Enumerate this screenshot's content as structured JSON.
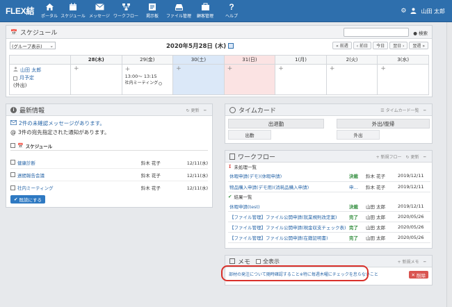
{
  "app": {
    "logo": "FLEX結",
    "user_name": "山田 太郎"
  },
  "nav": [
    {
      "label": "ポータル",
      "icon": "home-icon"
    },
    {
      "label": "スケジュール",
      "icon": "calendar-icon"
    },
    {
      "label": "メッセージ",
      "icon": "envelope-icon"
    },
    {
      "label": "ワークフロー",
      "icon": "workflow-icon"
    },
    {
      "label": "掲示板",
      "icon": "board-icon"
    },
    {
      "label": "ファイル管理",
      "icon": "drive-icon"
    },
    {
      "label": "顧客管理",
      "icon": "customer-icon"
    },
    {
      "label": "ヘルプ",
      "icon": "help-icon"
    }
  ],
  "schedule": {
    "title": "スケジュール",
    "search_label": "検索",
    "group_select": "(グループ表示)",
    "date_title": "2020年5月28日 (木)",
    "nav_buttons": [
      "« 前週",
      "‹ 前日",
      "今日",
      "翌日 ›",
      "翌週 »"
    ],
    "days": [
      "28(木)",
      "29(金)",
      "30(土)",
      "31(日)",
      "1(月)",
      "2(火)",
      "3(水)"
    ],
    "person": "山田 太郎",
    "monthly": "月予定",
    "status": "(外出)",
    "event_time": "13:00～ 13:15",
    "event_name": "社内ミーティング"
  },
  "info": {
    "title": "最新情報",
    "refresh": "更新",
    "unread": "2件の未確認メッセージがあります。",
    "notice": "3件の宛先指定された通知があります。",
    "section": "スケジュール",
    "rows": [
      {
        "title": "健康診断",
        "user": "鈴木 花子",
        "date": "12/11(水)"
      },
      {
        "title": "週間報告会議",
        "user": "鈴木 花子",
        "date": "12/11(水)"
      },
      {
        "title": "社内ミーティング",
        "user": "鈴木 花子",
        "date": "12/11(水)"
      }
    ],
    "read_button": "既読にする"
  },
  "timecard": {
    "title": "タイムカード",
    "list_link": "タイムカード一覧",
    "buttons": [
      "出退勤",
      "外出/復帰",
      "出勤",
      "外出"
    ]
  },
  "workflow": {
    "title": "ワークフロー",
    "new_link": "新規フロー",
    "refresh": "更新",
    "pending_header": "未処理一覧",
    "pending": [
      {
        "title": "休暇申請(デモ)(休暇申請)",
        "status": "決裁",
        "user": "鈴木 花子",
        "date": "2019/12/11"
      },
      {
        "title": "物品購入申請(デモ用)(消耗品購入申請)",
        "status": "申…",
        "user": "鈴木 花子",
        "date": "2019/12/11"
      }
    ],
    "done_header": "結果一覧",
    "done": [
      {
        "title": "休暇申請(test)",
        "status": "決裁",
        "user": "山田 太郎",
        "date": "2019/12/11"
      },
      {
        "title": "【ファイル管理】ファイル公開申請(就業規則改定案)",
        "status": "完了",
        "user": "山田 太郎",
        "date": "2020/05/26"
      },
      {
        "title": "【ファイル管理】ファイル公開申請(現金収支チェック表)",
        "status": "完了",
        "user": "山田 太郎",
        "date": "2020/05/26"
      },
      {
        "title": "【ファイル管理】ファイル公開申請(在籍証明書)",
        "status": "完了",
        "user": "山田 太郎",
        "date": "2020/05/26"
      }
    ]
  },
  "memo": {
    "title": "メモ",
    "show_all": "全表示",
    "new_link": "新規メモ",
    "text": "部材の発注について随時確認すること※特に毎週木曜にチェックを怠らないこと",
    "delete": "削除"
  },
  "colors": {
    "header": "#2e6fad",
    "saturday": "#dbe8f8",
    "sunday": "#fbe3e3",
    "highlight": "#d9302a",
    "confirm": "#2e79c2",
    "delete": "#d9534f"
  }
}
